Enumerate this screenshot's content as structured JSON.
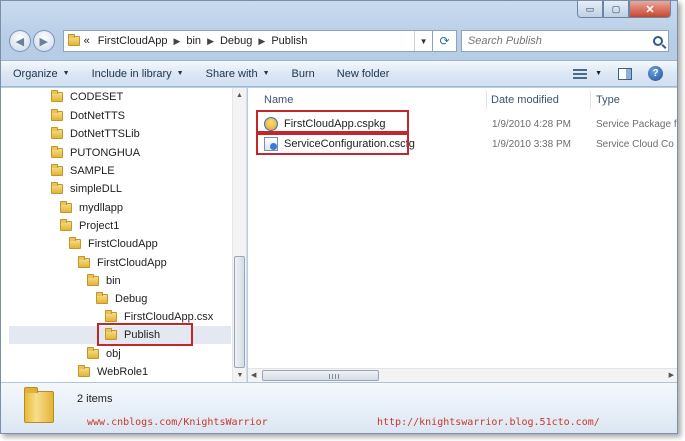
{
  "caption": {
    "minimize": "▭",
    "maximize": "▢",
    "close": "✕"
  },
  "navigation": {
    "back": "◀",
    "forward": "▶",
    "overflow": "«",
    "breadcrumbs": [
      "FirstCloudApp",
      "bin",
      "Debug",
      "Publish"
    ],
    "separator": "▶",
    "dropdown": "▼",
    "refresh": "⟳",
    "search_placeholder": "Search Publish"
  },
  "toolbar": {
    "items": [
      {
        "label": "Organize",
        "dropdown": "▼"
      },
      {
        "label": "Include in library",
        "dropdown": "▼"
      },
      {
        "label": "Share with",
        "dropdown": "▼"
      },
      {
        "label": "Burn"
      },
      {
        "label": "New folder"
      }
    ],
    "views_dropdown": "▼",
    "help": "?"
  },
  "tree": {
    "items": [
      {
        "label": "CODESET"
      },
      {
        "label": "DotNetTTS"
      },
      {
        "label": "DotNetTTSLib"
      },
      {
        "label": "PUTONGHUA"
      },
      {
        "label": "SAMPLE"
      },
      {
        "label": "simpleDLL"
      },
      {
        "label": "mydllapp"
      },
      {
        "label": "Project1"
      },
      {
        "label": "FirstCloudApp"
      },
      {
        "label": "FirstCloudApp"
      },
      {
        "label": "bin"
      },
      {
        "label": "Debug"
      },
      {
        "label": "FirstCloudApp.csx"
      },
      {
        "label": "Publish",
        "selected": true
      },
      {
        "label": "obj"
      },
      {
        "label": "WebRole1"
      }
    ],
    "scroll_up": "▲",
    "scroll_down": "▼"
  },
  "columns": {
    "name": "Name",
    "date_modified": "Date modified",
    "type": "Type"
  },
  "files": [
    {
      "name": "FirstCloudApp.cspkg",
      "date": "1/9/2010 4:28 PM",
      "type": "Service Package fi",
      "icon": "package-icon"
    },
    {
      "name": "ServiceConfiguration.cscfg",
      "date": "1/9/2010 3:38 PM",
      "type": "Service Cloud Co",
      "icon": "config-icon"
    }
  ],
  "hscroll": {
    "left": "◀",
    "right": "▶"
  },
  "details": {
    "item_count": "2 items",
    "watermark_left": "www.cnblogs.com/KnightsWarrior",
    "watermark_right": "http://knightswarrior.blog.51cto.com/"
  },
  "colors": {
    "highlight_box": "#c1272d",
    "watermark": "#c8372d",
    "selection": "#e4e9f1"
  }
}
